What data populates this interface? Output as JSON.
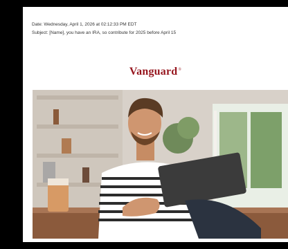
{
  "email": {
    "date_line": "Date: Wednesday, April 1, 2026 at 02:12:33 PM EDT",
    "subject_line": "Subject: [Name], you have an IRA, so contribute for 2025 before April 15"
  },
  "brand": {
    "logo_text": "Vanguard",
    "logo_mark": "®",
    "color": "#96151D"
  },
  "hero": {
    "icon": "person-with-tablet-photo"
  }
}
